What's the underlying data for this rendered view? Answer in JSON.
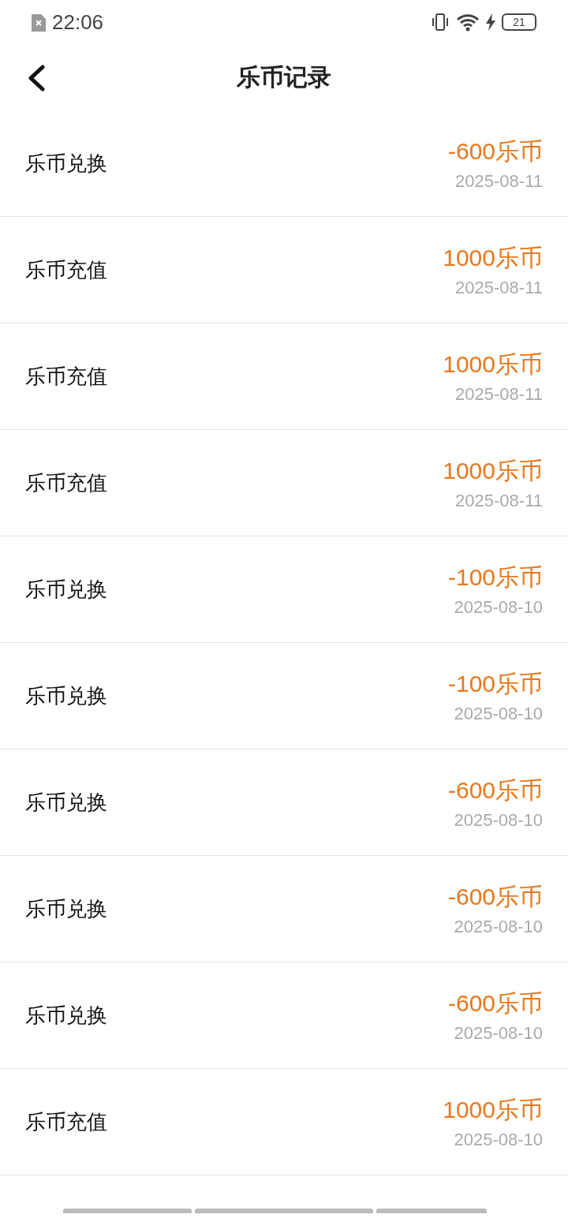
{
  "status_bar": {
    "time": "22:06",
    "battery": "21"
  },
  "header": {
    "title": "乐币记录"
  },
  "records": [
    {
      "name": "乐币兑换",
      "amount": "-600乐币",
      "date": "2025-08-11"
    },
    {
      "name": "乐币充值",
      "amount": "1000乐币",
      "date": "2025-08-11"
    },
    {
      "name": "乐币充值",
      "amount": "1000乐币",
      "date": "2025-08-11"
    },
    {
      "name": "乐币充值",
      "amount": "1000乐币",
      "date": "2025-08-11"
    },
    {
      "name": "乐币兑换",
      "amount": "-100乐币",
      "date": "2025-08-10"
    },
    {
      "name": "乐币兑换",
      "amount": "-100乐币",
      "date": "2025-08-10"
    },
    {
      "name": "乐币兑换",
      "amount": "-600乐币",
      "date": "2025-08-10"
    },
    {
      "name": "乐币兑换",
      "amount": "-600乐币",
      "date": "2025-08-10"
    },
    {
      "name": "乐币兑换",
      "amount": "-600乐币",
      "date": "2025-08-10"
    },
    {
      "name": "乐币充值",
      "amount": "1000乐币",
      "date": "2025-08-10"
    }
  ]
}
